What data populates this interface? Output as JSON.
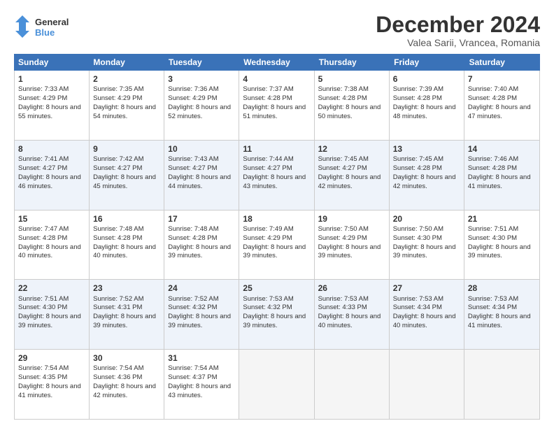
{
  "logo": {
    "line1": "General",
    "line2": "Blue"
  },
  "title": "December 2024",
  "location": "Valea Sarii, Vrancea, Romania",
  "header_days": [
    "Sunday",
    "Monday",
    "Tuesday",
    "Wednesday",
    "Thursday",
    "Friday",
    "Saturday"
  ],
  "rows": [
    {
      "alt": false,
      "cells": [
        {
          "day": "1",
          "info": "Sunrise: 7:33 AM\nSunset: 4:29 PM\nDaylight: 8 hours and 55 minutes.",
          "empty": false
        },
        {
          "day": "2",
          "info": "Sunrise: 7:35 AM\nSunset: 4:29 PM\nDaylight: 8 hours and 54 minutes.",
          "empty": false
        },
        {
          "day": "3",
          "info": "Sunrise: 7:36 AM\nSunset: 4:29 PM\nDaylight: 8 hours and 52 minutes.",
          "empty": false
        },
        {
          "day": "4",
          "info": "Sunrise: 7:37 AM\nSunset: 4:28 PM\nDaylight: 8 hours and 51 minutes.",
          "empty": false
        },
        {
          "day": "5",
          "info": "Sunrise: 7:38 AM\nSunset: 4:28 PM\nDaylight: 8 hours and 50 minutes.",
          "empty": false
        },
        {
          "day": "6",
          "info": "Sunrise: 7:39 AM\nSunset: 4:28 PM\nDaylight: 8 hours and 48 minutes.",
          "empty": false
        },
        {
          "day": "7",
          "info": "Sunrise: 7:40 AM\nSunset: 4:28 PM\nDaylight: 8 hours and 47 minutes.",
          "empty": false
        }
      ]
    },
    {
      "alt": true,
      "cells": [
        {
          "day": "8",
          "info": "Sunrise: 7:41 AM\nSunset: 4:27 PM\nDaylight: 8 hours and 46 minutes.",
          "empty": false
        },
        {
          "day": "9",
          "info": "Sunrise: 7:42 AM\nSunset: 4:27 PM\nDaylight: 8 hours and 45 minutes.",
          "empty": false
        },
        {
          "day": "10",
          "info": "Sunrise: 7:43 AM\nSunset: 4:27 PM\nDaylight: 8 hours and 44 minutes.",
          "empty": false
        },
        {
          "day": "11",
          "info": "Sunrise: 7:44 AM\nSunset: 4:27 PM\nDaylight: 8 hours and 43 minutes.",
          "empty": false
        },
        {
          "day": "12",
          "info": "Sunrise: 7:45 AM\nSunset: 4:27 PM\nDaylight: 8 hours and 42 minutes.",
          "empty": false
        },
        {
          "day": "13",
          "info": "Sunrise: 7:45 AM\nSunset: 4:28 PM\nDaylight: 8 hours and 42 minutes.",
          "empty": false
        },
        {
          "day": "14",
          "info": "Sunrise: 7:46 AM\nSunset: 4:28 PM\nDaylight: 8 hours and 41 minutes.",
          "empty": false
        }
      ]
    },
    {
      "alt": false,
      "cells": [
        {
          "day": "15",
          "info": "Sunrise: 7:47 AM\nSunset: 4:28 PM\nDaylight: 8 hours and 40 minutes.",
          "empty": false
        },
        {
          "day": "16",
          "info": "Sunrise: 7:48 AM\nSunset: 4:28 PM\nDaylight: 8 hours and 40 minutes.",
          "empty": false
        },
        {
          "day": "17",
          "info": "Sunrise: 7:48 AM\nSunset: 4:28 PM\nDaylight: 8 hours and 39 minutes.",
          "empty": false
        },
        {
          "day": "18",
          "info": "Sunrise: 7:49 AM\nSunset: 4:29 PM\nDaylight: 8 hours and 39 minutes.",
          "empty": false
        },
        {
          "day": "19",
          "info": "Sunrise: 7:50 AM\nSunset: 4:29 PM\nDaylight: 8 hours and 39 minutes.",
          "empty": false
        },
        {
          "day": "20",
          "info": "Sunrise: 7:50 AM\nSunset: 4:30 PM\nDaylight: 8 hours and 39 minutes.",
          "empty": false
        },
        {
          "day": "21",
          "info": "Sunrise: 7:51 AM\nSunset: 4:30 PM\nDaylight: 8 hours and 39 minutes.",
          "empty": false
        }
      ]
    },
    {
      "alt": true,
      "cells": [
        {
          "day": "22",
          "info": "Sunrise: 7:51 AM\nSunset: 4:30 PM\nDaylight: 8 hours and 39 minutes.",
          "empty": false
        },
        {
          "day": "23",
          "info": "Sunrise: 7:52 AM\nSunset: 4:31 PM\nDaylight: 8 hours and 39 minutes.",
          "empty": false
        },
        {
          "day": "24",
          "info": "Sunrise: 7:52 AM\nSunset: 4:32 PM\nDaylight: 8 hours and 39 minutes.",
          "empty": false
        },
        {
          "day": "25",
          "info": "Sunrise: 7:53 AM\nSunset: 4:32 PM\nDaylight: 8 hours and 39 minutes.",
          "empty": false
        },
        {
          "day": "26",
          "info": "Sunrise: 7:53 AM\nSunset: 4:33 PM\nDaylight: 8 hours and 40 minutes.",
          "empty": false
        },
        {
          "day": "27",
          "info": "Sunrise: 7:53 AM\nSunset: 4:34 PM\nDaylight: 8 hours and 40 minutes.",
          "empty": false
        },
        {
          "day": "28",
          "info": "Sunrise: 7:53 AM\nSunset: 4:34 PM\nDaylight: 8 hours and 41 minutes.",
          "empty": false
        }
      ]
    },
    {
      "alt": false,
      "cells": [
        {
          "day": "29",
          "info": "Sunrise: 7:54 AM\nSunset: 4:35 PM\nDaylight: 8 hours and 41 minutes.",
          "empty": false
        },
        {
          "day": "30",
          "info": "Sunrise: 7:54 AM\nSunset: 4:36 PM\nDaylight: 8 hours and 42 minutes.",
          "empty": false
        },
        {
          "day": "31",
          "info": "Sunrise: 7:54 AM\nSunset: 4:37 PM\nDaylight: 8 hours and 43 minutes.",
          "empty": false
        },
        {
          "day": "",
          "info": "",
          "empty": true
        },
        {
          "day": "",
          "info": "",
          "empty": true
        },
        {
          "day": "",
          "info": "",
          "empty": true
        },
        {
          "day": "",
          "info": "",
          "empty": true
        }
      ]
    }
  ]
}
